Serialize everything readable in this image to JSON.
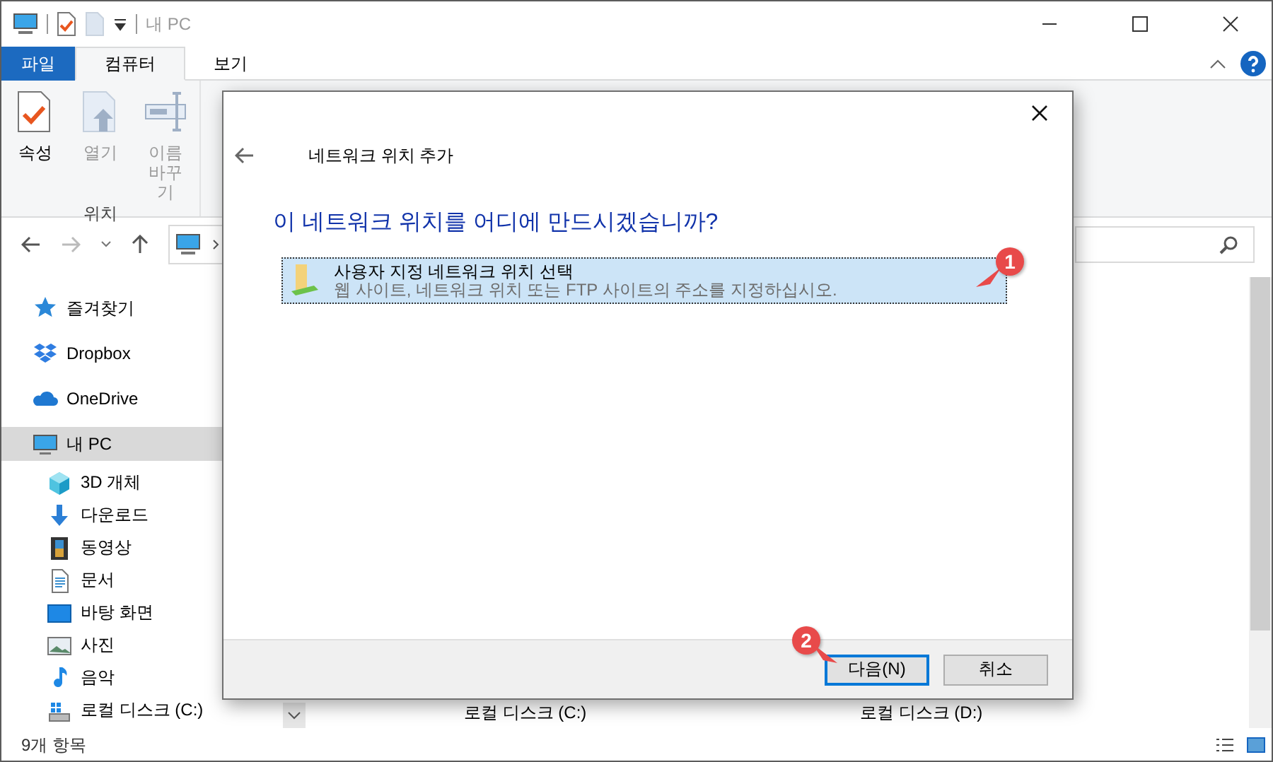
{
  "window": {
    "title": "내 PC"
  },
  "ribbon": {
    "tabs": [
      {
        "label": "파일",
        "kind": "file",
        "selected": false
      },
      {
        "label": "컴퓨터",
        "kind": "tab",
        "selected": true
      },
      {
        "label": "보기",
        "kind": "tab",
        "selected": false
      }
    ],
    "buttons": [
      {
        "label": "속성",
        "kind": "properties",
        "disabled": false
      },
      {
        "label": "열기",
        "kind": "open",
        "disabled": true
      },
      {
        "label": "이름 바꾸기",
        "kind": "rename",
        "disabled": true
      }
    ],
    "group_label": "위치"
  },
  "sidebar": {
    "items": [
      {
        "label": "즐겨찾기",
        "kind": "star",
        "selected": false
      },
      {
        "label": "Dropbox",
        "kind": "dropbox",
        "selected": false
      },
      {
        "label": "OneDrive",
        "kind": "cloud",
        "selected": false
      },
      {
        "label": "내 PC",
        "kind": "pc",
        "selected": true,
        "children": [
          {
            "label": "3D 개체",
            "kind": "cube",
            "selected": false
          },
          {
            "label": "다운로드",
            "kind": "download",
            "selected": false
          },
          {
            "label": "동영상",
            "kind": "film",
            "selected": false
          },
          {
            "label": "문서",
            "kind": "document",
            "selected": false
          },
          {
            "label": "바탕 화면",
            "kind": "desktop",
            "selected": false
          },
          {
            "label": "사진",
            "kind": "photo",
            "selected": false
          },
          {
            "label": "음악",
            "kind": "music",
            "selected": false
          },
          {
            "label": "로컬 디스크 (C:)",
            "kind": "drive",
            "selected": false
          }
        ]
      }
    ]
  },
  "content": {
    "items": [
      {
        "label": "로컬 디스크 (C:)"
      },
      {
        "label": "로컬 디스크 (D:)"
      }
    ]
  },
  "status_bar": {
    "text": "9개 항목"
  },
  "dialog": {
    "title": "네트워크 위치 추가",
    "heading": "이 네트워크 위치를 어디에 만드시겠습니까?",
    "options": [
      {
        "title": "사용자 지정 네트워크 위치 선택",
        "description": "웹 사이트, 네트워크 위치 또는 FTP 사이트의 주소를 지정하십시오.",
        "selected": true,
        "annotation": "1"
      }
    ],
    "buttons": [
      {
        "label": "다음(N)",
        "default": true,
        "annotation": "2"
      },
      {
        "label": "취소",
        "default": false
      }
    ]
  }
}
